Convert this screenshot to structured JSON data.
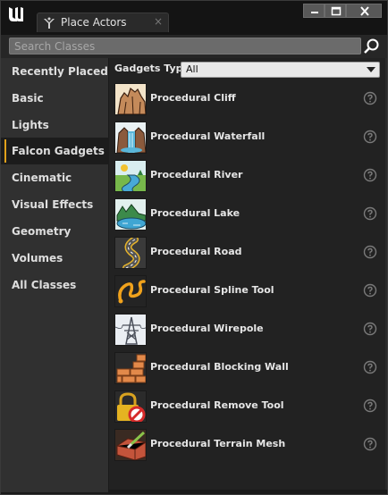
{
  "window": {
    "tab_title": "Place Actors",
    "tab_close": "×"
  },
  "search": {
    "placeholder": "Search Classes",
    "value": ""
  },
  "sidebar": {
    "items": [
      {
        "label": "Recently Placed"
      },
      {
        "label": "Basic"
      },
      {
        "label": "Lights"
      },
      {
        "label": "Falcon Gadgets",
        "active": true
      },
      {
        "label": "Cinematic"
      },
      {
        "label": "Visual Effects"
      },
      {
        "label": "Geometry"
      },
      {
        "label": "Volumes"
      },
      {
        "label": "All Classes"
      }
    ]
  },
  "filter": {
    "label": "Gadgets Type :",
    "selected": "All"
  },
  "items": [
    {
      "label": "Procedural Cliff",
      "icon": "cliff-icon"
    },
    {
      "label": "Procedural Waterfall",
      "icon": "waterfall-icon"
    },
    {
      "label": "Procedural River",
      "icon": "river-icon"
    },
    {
      "label": "Procedural Lake",
      "icon": "lake-icon"
    },
    {
      "label": "Procedural Road",
      "icon": "road-icon"
    },
    {
      "label": "Procedural Spline Tool",
      "icon": "spline-icon"
    },
    {
      "label": "Procedural Wirepole",
      "icon": "wirepole-icon"
    },
    {
      "label": "Procedural Blocking Wall",
      "icon": "wall-icon"
    },
    {
      "label": "Procedural Remove Tool",
      "icon": "remove-icon"
    },
    {
      "label": "Procedural Terrain Mesh",
      "icon": "terrain-icon"
    }
  ],
  "colors": {
    "accent": "#e0a11b",
    "sidebar_bg": "#303030",
    "panel_bg": "#222222"
  }
}
